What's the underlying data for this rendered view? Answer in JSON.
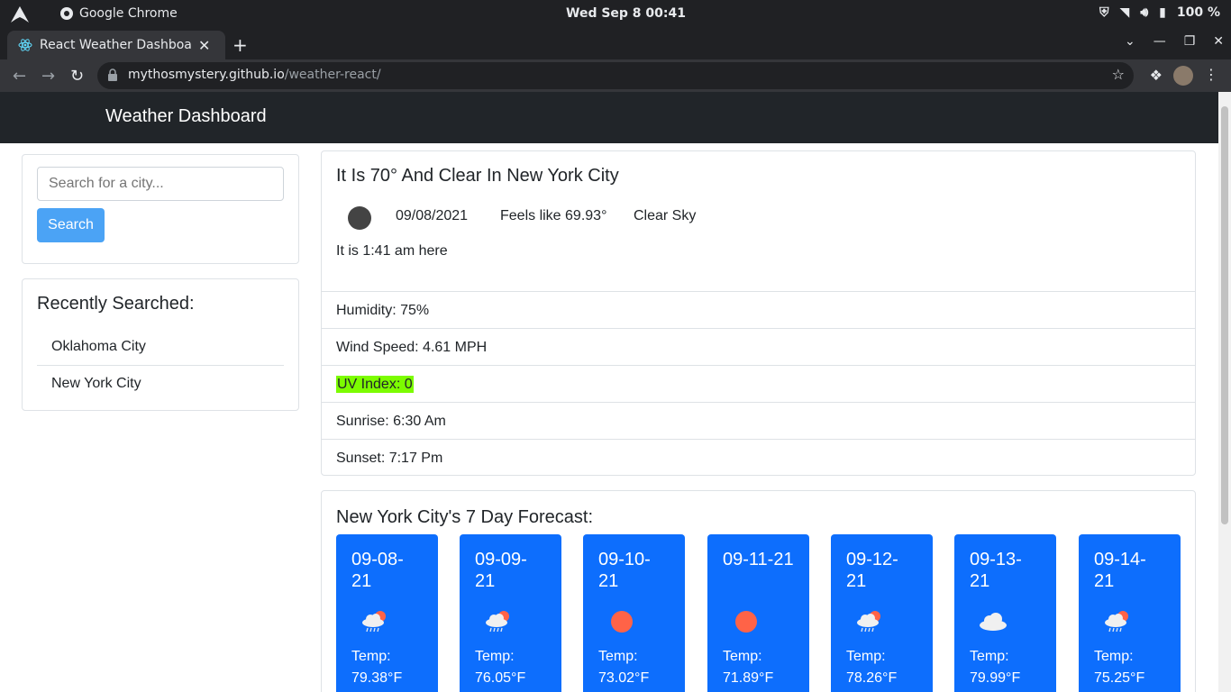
{
  "os": {
    "app_name": "Google Chrome",
    "clock": "Wed Sep 8  00:41",
    "battery": "100 %"
  },
  "browser": {
    "tab_title": "React Weather Dashboard",
    "url_host": "mythosmystery.github.io",
    "url_path": "/weather-react/"
  },
  "page": {
    "brand": "Weather Dashboard",
    "search": {
      "placeholder": "Search for a city...",
      "button": "Search"
    },
    "recent": {
      "title": "Recently Searched:",
      "items": [
        "Oklahoma City",
        "New York City"
      ]
    },
    "current": {
      "heading": "It Is 70° And Clear In New York City",
      "date": "09/08/2021",
      "feels_like": "Feels like 69.93°",
      "description": "Clear Sky",
      "local_time": "It is 1:41 am here",
      "humidity": "Humidity: 75%",
      "wind": "Wind Speed: 4.61 MPH",
      "uv": "UV Index: 0",
      "uv_color": "#7cfc00",
      "sunrise": "Sunrise: 6:30 Am",
      "sunset": "Sunset: 7:17 Pm"
    },
    "forecast": {
      "title": "New York City's 7 Day Forecast:",
      "days": [
        {
          "date": "09-08-21",
          "icon": "rain-cloud-sun-icon",
          "temp_label": "Temp:",
          "temp": "79.38°F"
        },
        {
          "date": "09-09-21",
          "icon": "rain-cloud-sun-icon",
          "temp_label": "Temp:",
          "temp": "76.05°F"
        },
        {
          "date": "09-10-21",
          "icon": "sun-icon",
          "temp_label": "Temp:",
          "temp": "73.02°F"
        },
        {
          "date": "09-11-21",
          "icon": "sun-icon",
          "temp_label": "Temp:",
          "temp": "71.89°F"
        },
        {
          "date": "09-12-21",
          "icon": "rain-cloud-sun-icon",
          "temp_label": "Temp:",
          "temp": "78.26°F"
        },
        {
          "date": "09-13-21",
          "icon": "cloud-icon",
          "temp_label": "Temp:",
          "temp": "79.99°F"
        },
        {
          "date": "09-14-21",
          "icon": "rain-cloud-sun-icon",
          "temp_label": "Temp:",
          "temp": "75.25°F"
        }
      ]
    }
  },
  "colors": {
    "navbar": "#212529",
    "search_button": "#4ba3f5",
    "forecast_card": "#0d6efd",
    "sun": "#ff6347"
  }
}
